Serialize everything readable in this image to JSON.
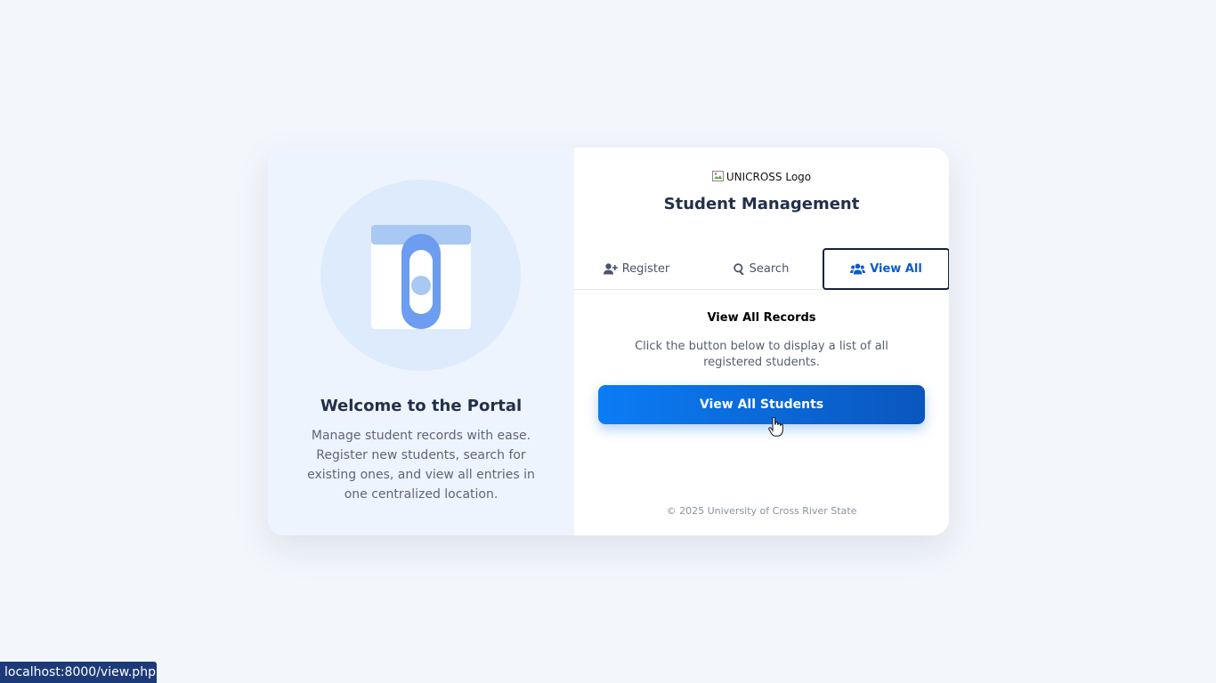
{
  "welcome": {
    "title": "Welcome to the Portal",
    "text": "Manage student records with ease. Register new students, search for existing ones, and view all entries in one centralized location."
  },
  "header": {
    "logo_alt": "UNICROSS Logo",
    "title": "Student Management"
  },
  "tabs": [
    {
      "label": "Register",
      "icon": "user-plus-icon",
      "active": false
    },
    {
      "label": "Search",
      "icon": "search-icon",
      "active": false
    },
    {
      "label": "View All",
      "icon": "users-icon",
      "active": true
    }
  ],
  "view_all": {
    "title": "View All Records",
    "description": "Click the button below to display a list of all registered students.",
    "button_label": "View All Students"
  },
  "footer": {
    "text": "© 2025 University of Cross River State"
  },
  "status_bar": {
    "url": "localhost:8000/view.php"
  },
  "colors": {
    "accent": "#0b5cc8",
    "button_start": "#0b7cf5",
    "button_end": "#0a56bd",
    "panel": "#eef4fd",
    "background": "#f3f6fb"
  }
}
